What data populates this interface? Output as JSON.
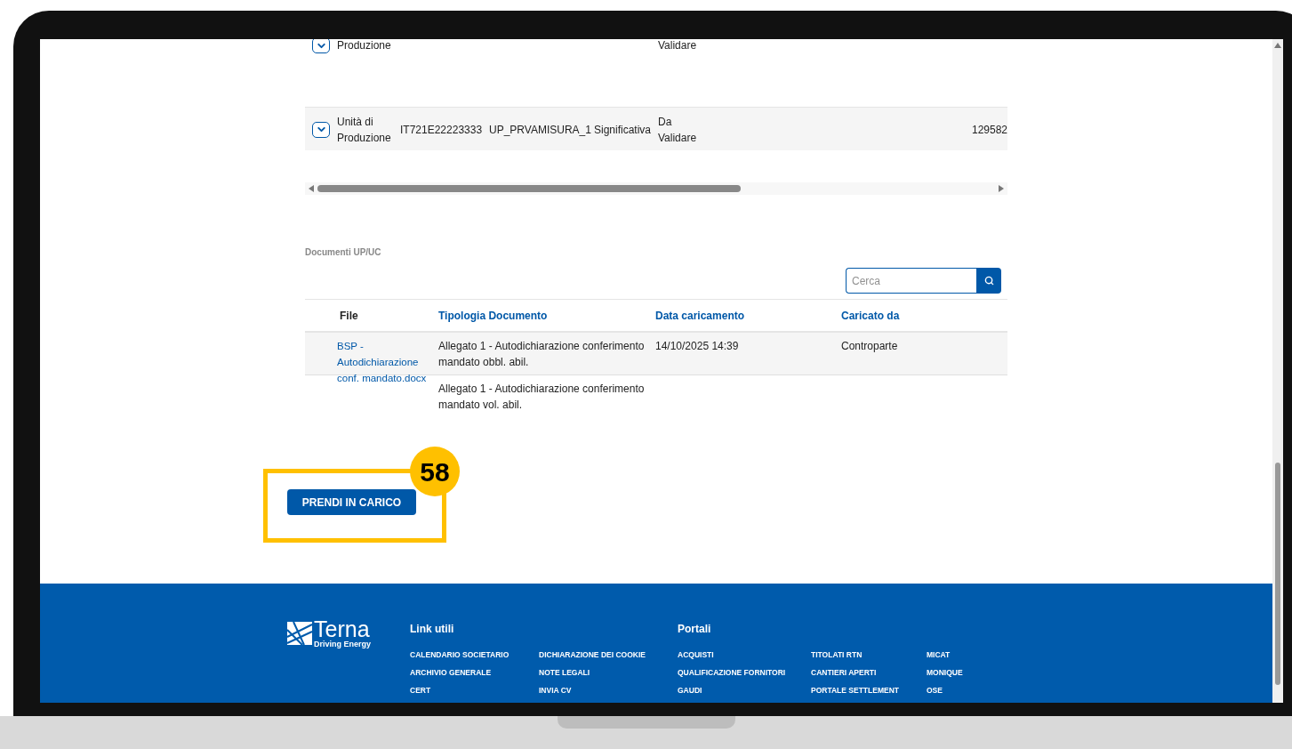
{
  "units_table": {
    "rows": [
      {
        "column_1": "Produzione",
        "column_2": "",
        "column_3": "",
        "column_4": "",
        "column_5": "Validare",
        "column_6": ""
      },
      {
        "column_1": "Unità di Produzione",
        "column_2": "IT721E22223333",
        "column_3": "UP_PRVAMISURA_1",
        "column_4": "Significativa",
        "column_5": "Da Validare",
        "column_6": "129582"
      }
    ]
  },
  "documents": {
    "title": "Documenti UP/UC",
    "search": {
      "placeholder": "Cerca"
    },
    "columns": [
      {
        "label": "File",
        "sortable": false
      },
      {
        "label": "Tipologia Documento",
        "sortable": true
      },
      {
        "label": "Data caricamento",
        "sortable": true
      },
      {
        "label": "Caricato da",
        "sortable": true
      }
    ],
    "rows": [
      {
        "file": "BSP - Autodichiarazione conf. mandato.docx",
        "type": "Allegato 1 - Autodichiarazione conferimento mandato obbl. abil.",
        "date": "14/10/2025 14:39",
        "uploaded_by": "Controparte"
      },
      {
        "file": "",
        "type": "Allegato 1 - Autodichiarazione conferimento mandato vol. abil.",
        "date": "",
        "uploaded_by": ""
      }
    ]
  },
  "action_button": {
    "label": "PRENDI IN CARICO",
    "callout": "58"
  },
  "footer": {
    "logo": {
      "name": "Terna",
      "tagline": "Driving Energy"
    },
    "groups": [
      {
        "title": "Link utili",
        "columns": [
          [
            "CALENDARIO SOCIETARIO",
            "ARCHIVIO GENERALE",
            "CERT"
          ],
          [
            "DICHIARAZIONE DEI COOKIE",
            "NOTE LEGALI",
            "INVIA CV"
          ]
        ]
      },
      {
        "title": "Portali",
        "columns": [
          [
            "ACQUISTI",
            "QUALIFICAZIONE FORNITORI",
            "GAUDI"
          ],
          [
            "TITOLATI RTN",
            "CANTIERI APERTI",
            "PORTALE SETTLEMENT"
          ],
          [
            "MICAT",
            "MONIQUE",
            "OSE"
          ]
        ]
      }
    ]
  }
}
